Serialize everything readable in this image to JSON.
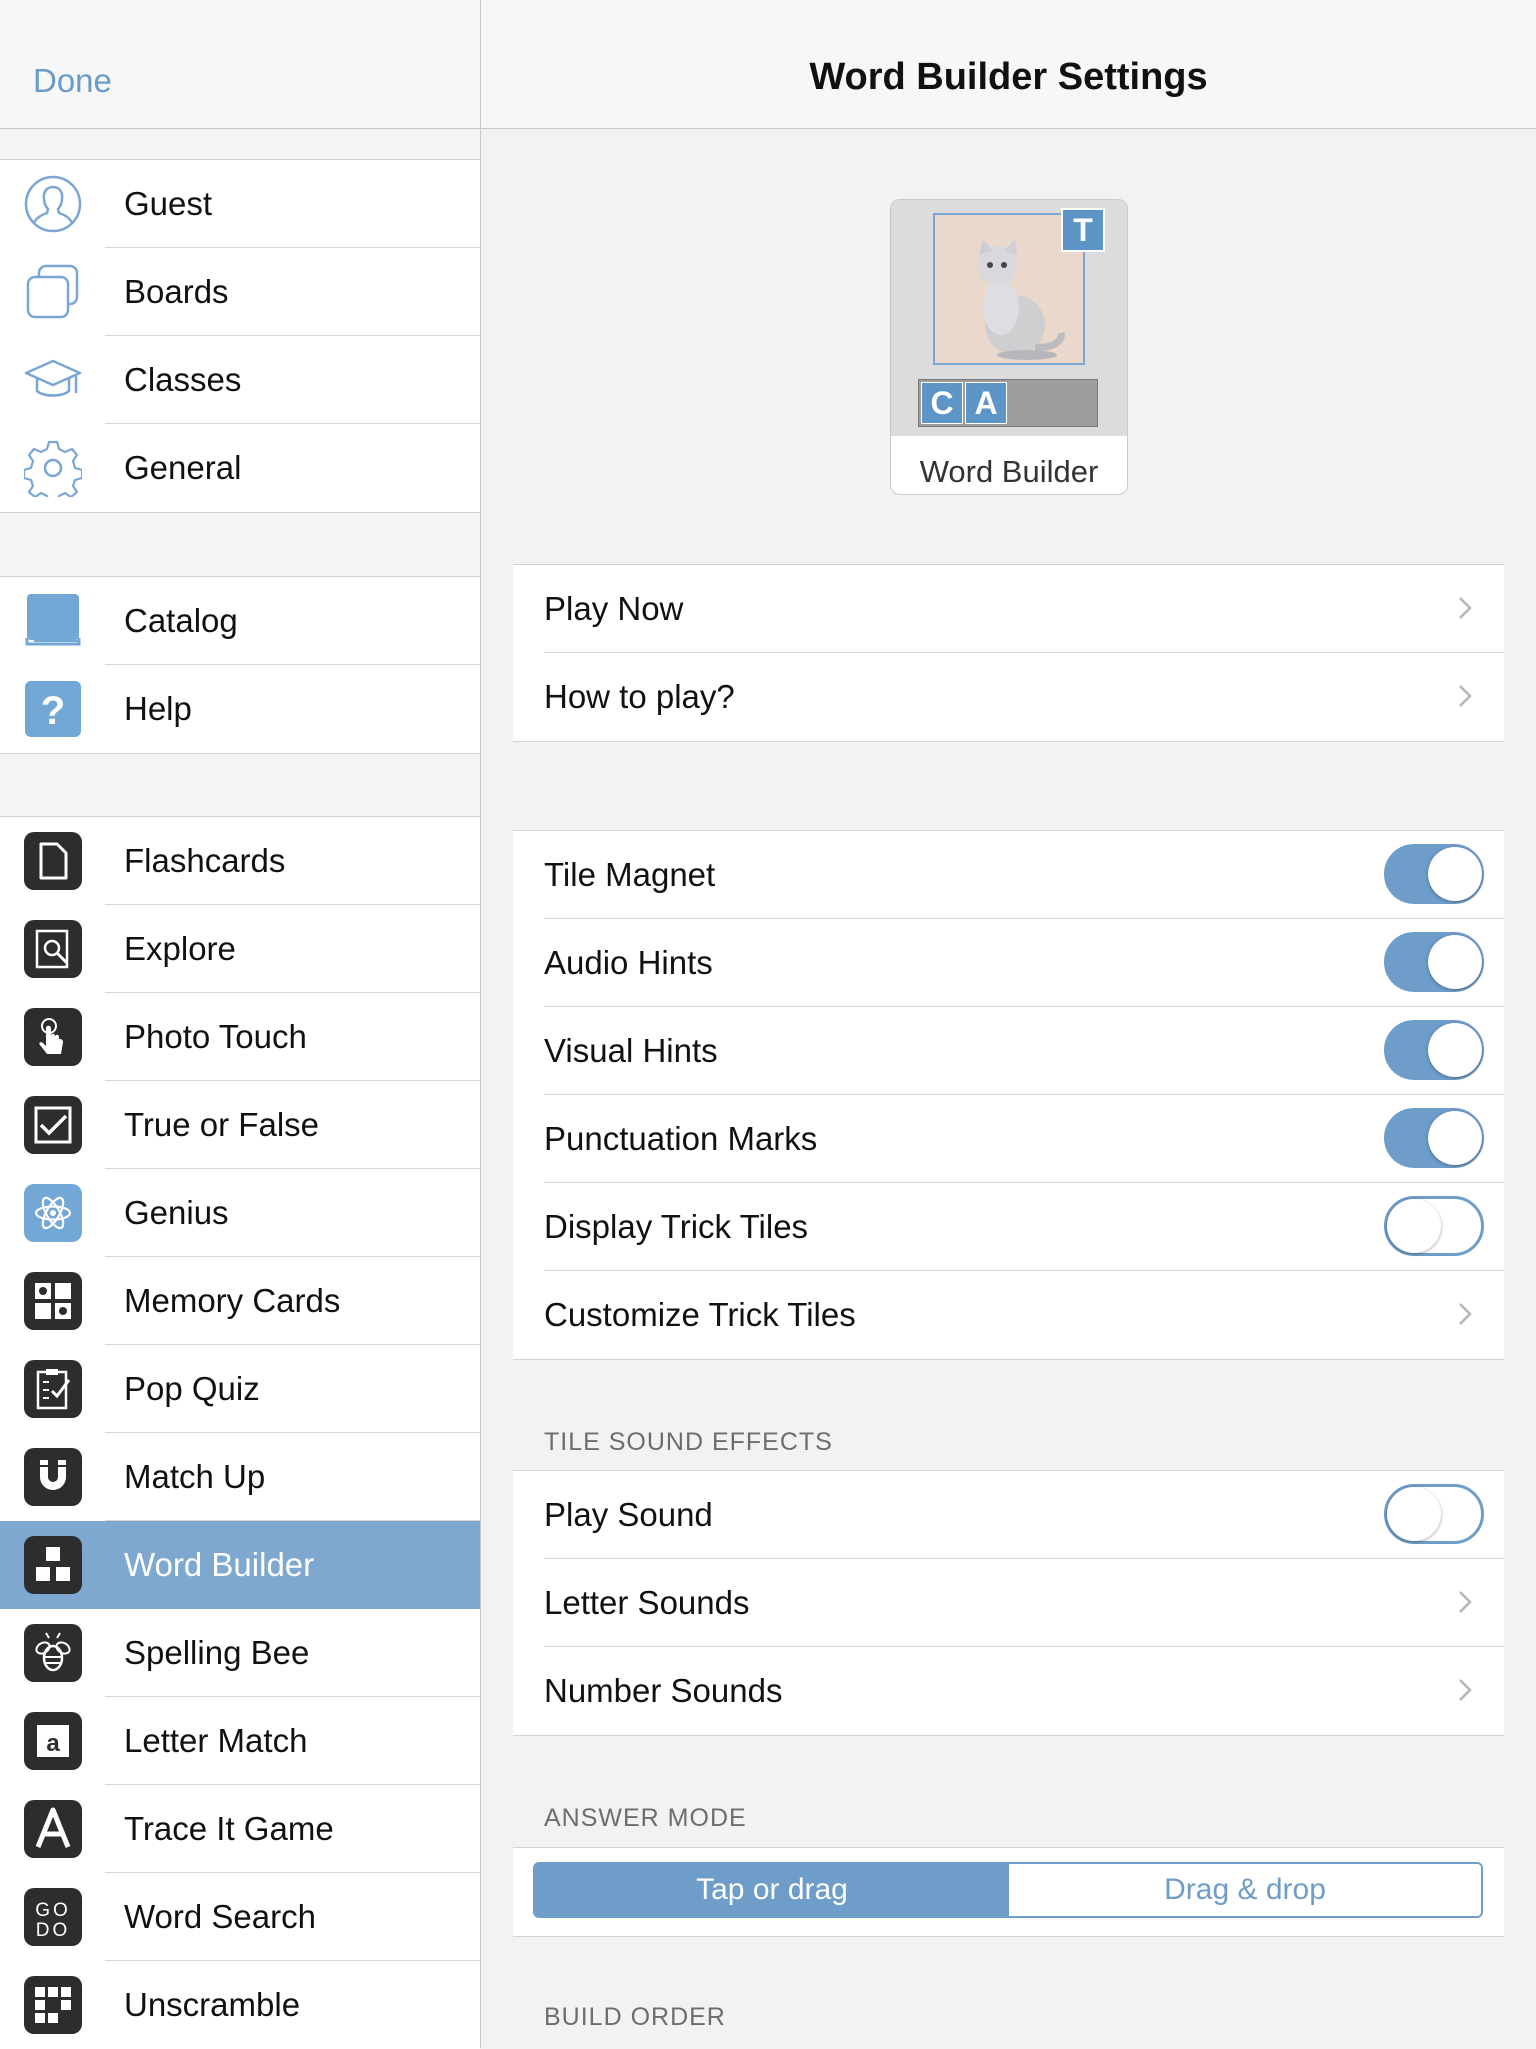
{
  "sidebar": {
    "done_label": "Done",
    "group1": [
      {
        "label": "Guest",
        "icon": "user-icon"
      },
      {
        "label": "Boards",
        "icon": "boards-icon"
      },
      {
        "label": "Classes",
        "icon": "graduation-cap-icon"
      },
      {
        "label": "General",
        "icon": "gear-icon"
      }
    ],
    "group2": [
      {
        "label": "Catalog",
        "icon": "book-icon"
      },
      {
        "label": "Help",
        "icon": "question-icon"
      }
    ],
    "group3": [
      {
        "label": "Flashcards",
        "icon": "flashcard-icon"
      },
      {
        "label": "Explore",
        "icon": "magnifier-icon"
      },
      {
        "label": "Photo Touch",
        "icon": "finger-touch-icon"
      },
      {
        "label": "True or False",
        "icon": "checkbox-icon"
      },
      {
        "label": "Genius",
        "icon": "atom-icon"
      },
      {
        "label": "Memory Cards",
        "icon": "memory-grid-icon"
      },
      {
        "label": "Pop Quiz",
        "icon": "clipboard-check-icon"
      },
      {
        "label": "Match Up",
        "icon": "magnet-icon"
      },
      {
        "label": "Word Builder",
        "icon": "blocks-icon",
        "selected": true
      },
      {
        "label": "Spelling Bee",
        "icon": "bee-icon"
      },
      {
        "label": "Letter Match",
        "icon": "letter-a-tile-icon"
      },
      {
        "label": "Trace It Game",
        "icon": "trace-a-icon"
      },
      {
        "label": "Word Search",
        "icon": "word-search-icon"
      },
      {
        "label": "Unscramble",
        "icon": "unscramble-grid-icon"
      }
    ]
  },
  "main": {
    "title": "Word Builder Settings",
    "app_card": {
      "label": "Word Builder",
      "badge": "T",
      "tiles": [
        "C",
        "A"
      ]
    },
    "nav_group": [
      {
        "label": "Play Now"
      },
      {
        "label": "How to play?"
      }
    ],
    "options_group": [
      {
        "label": "Tile Magnet",
        "type": "toggle",
        "on": true
      },
      {
        "label": "Audio Hints",
        "type": "toggle",
        "on": true
      },
      {
        "label": "Visual Hints",
        "type": "toggle",
        "on": true
      },
      {
        "label": "Punctuation Marks",
        "type": "toggle",
        "on": true
      },
      {
        "label": "Display Trick Tiles",
        "type": "toggle",
        "on": false
      },
      {
        "label": "Customize Trick Tiles",
        "type": "link"
      }
    ],
    "tile_sound_header": "TILE SOUND EFFECTS",
    "sound_group": [
      {
        "label": "Play Sound",
        "type": "toggle",
        "on": false
      },
      {
        "label": "Letter Sounds",
        "type": "link"
      },
      {
        "label": "Number Sounds",
        "type": "link"
      }
    ],
    "answer_mode_header": "ANSWER MODE",
    "answer_mode": {
      "options": [
        "Tap or drag",
        "Drag & drop"
      ],
      "selected": "Tap or drag"
    },
    "build_order_header": "BUILD ORDER"
  },
  "colors": {
    "accent": "#6e9dca",
    "selected_row": "#7ea8cf",
    "icon_dark": "#2d2d2d"
  }
}
